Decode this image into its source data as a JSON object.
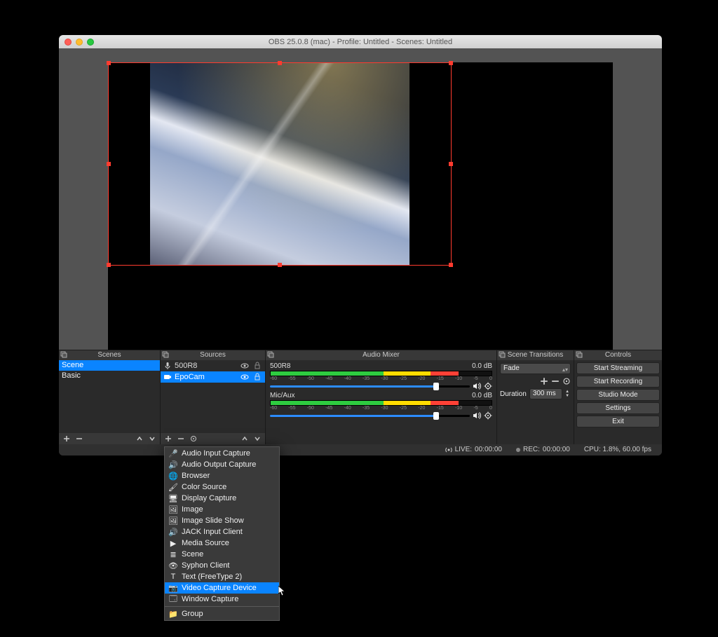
{
  "window_title": "OBS 25.0.8 (mac) - Profile: Untitled - Scenes: Untitled",
  "scenes": {
    "header": "Scenes",
    "items": [
      "Scene",
      "Basic"
    ]
  },
  "sources": {
    "header": "Sources",
    "items": [
      {
        "label": "500R8",
        "visible": true,
        "locked": false,
        "icon": "mic"
      },
      {
        "label": "EpoCam",
        "visible": true,
        "locked": false,
        "icon": "camera"
      }
    ]
  },
  "mixer": {
    "header": "Audio Mixer",
    "channels": [
      {
        "name": "500R8",
        "db": "0.0 dB"
      },
      {
        "name": "Mic/Aux",
        "db": "0.0 dB"
      }
    ],
    "ticks": [
      "-60",
      "-55",
      "-50",
      "-45",
      "-40",
      "-35",
      "-30",
      "-25",
      "-20",
      "-15",
      "-10",
      "-5",
      "0"
    ]
  },
  "transitions": {
    "header": "Scene Transitions",
    "current": "Fade",
    "duration_label": "Duration",
    "duration_value": "300 ms"
  },
  "controls": {
    "header": "Controls",
    "buttons": [
      "Start Streaming",
      "Start Recording",
      "Studio Mode",
      "Settings",
      "Exit"
    ]
  },
  "status": {
    "live_label": "LIVE:",
    "live_time": "00:00:00",
    "rec_label": "REC:",
    "rec_time": "00:00:00",
    "cpu": "CPU: 1.8%, 60.00 fps"
  },
  "popup": {
    "items": [
      "Audio Input Capture",
      "Audio Output Capture",
      "Browser",
      "Color Source",
      "Display Capture",
      "Image",
      "Image Slide Show",
      "JACK Input Client",
      "Media Source",
      "Scene",
      "Syphon Client",
      "Text (FreeType 2)",
      "Video Capture Device",
      "Window Capture"
    ],
    "selected_index": 12,
    "group_label": "Group"
  }
}
